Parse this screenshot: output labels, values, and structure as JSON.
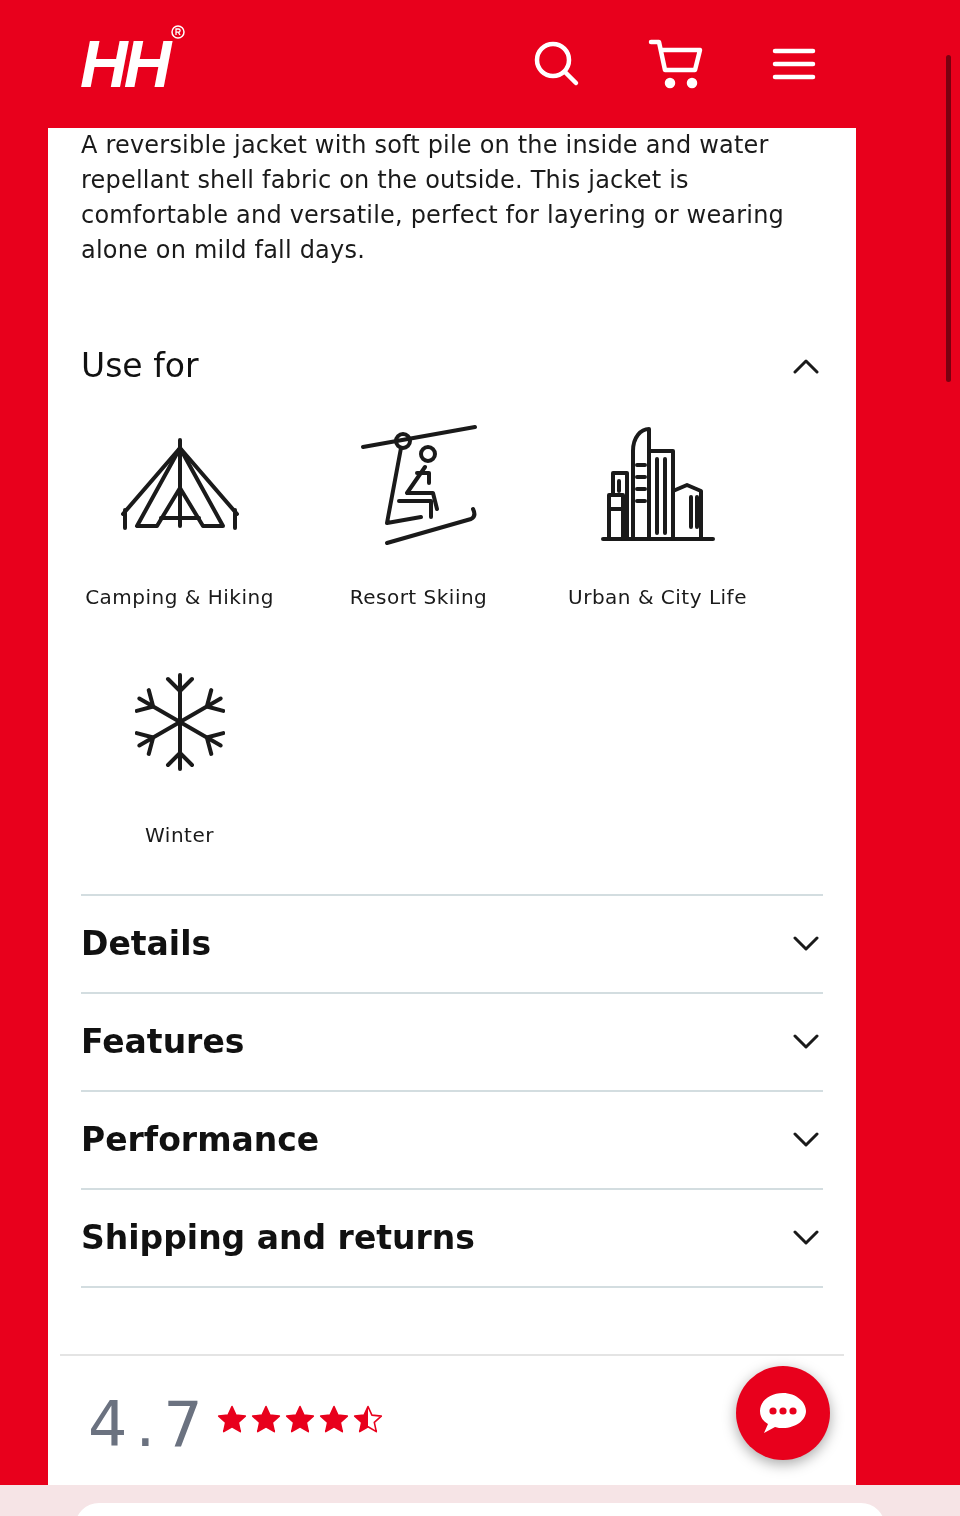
{
  "header": {
    "logo": "HH"
  },
  "description": "A reversible jacket with soft pile on the inside and water repellant shell fabric on the outside. This jacket is comfortable and versatile, perfect for layering or wearing alone on mild fall days.",
  "sections": [
    {
      "title": "Use for",
      "expanded": true,
      "items": [
        {
          "kind": "tent",
          "label": "Camping & Hiking"
        },
        {
          "kind": "chairlift",
          "label": "Resort Skiing"
        },
        {
          "kind": "city",
          "label": "Urban & City Life"
        },
        {
          "kind": "snowflake",
          "label": "Winter"
        }
      ]
    },
    {
      "title": "Details",
      "expanded": false
    },
    {
      "title": "Features",
      "expanded": false
    },
    {
      "title": "Performance",
      "expanded": false
    },
    {
      "title": "Shipping and returns",
      "expanded": false
    }
  ],
  "rating": {
    "score": "4.7",
    "stars": 4.5
  }
}
